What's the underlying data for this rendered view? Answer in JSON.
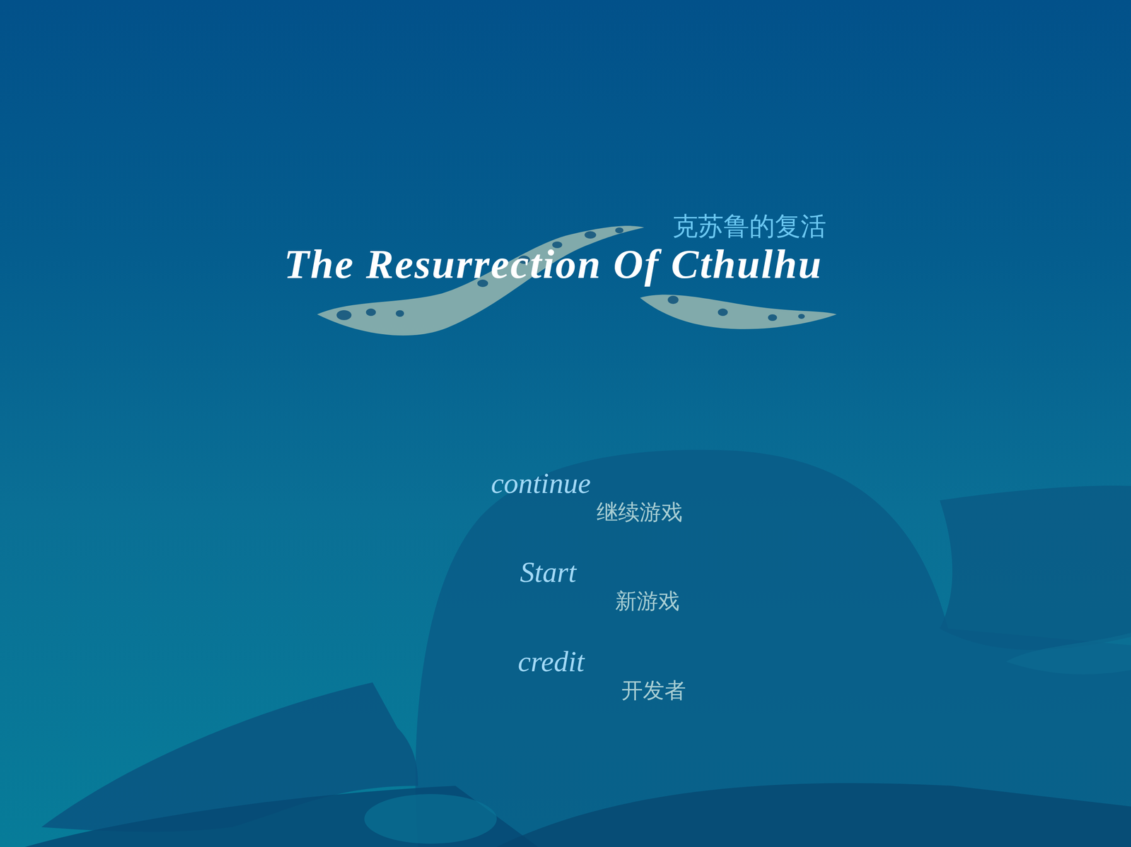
{
  "title": {
    "chinese": "克苏鲁的复活",
    "english": "The Resurrection Of Cthulhu"
  },
  "menu": [
    {
      "label": "continue",
      "sublabel": "继续游戏"
    },
    {
      "label": "Start",
      "sublabel": "新游戏"
    },
    {
      "label": "credit",
      "sublabel": "开发者"
    }
  ]
}
